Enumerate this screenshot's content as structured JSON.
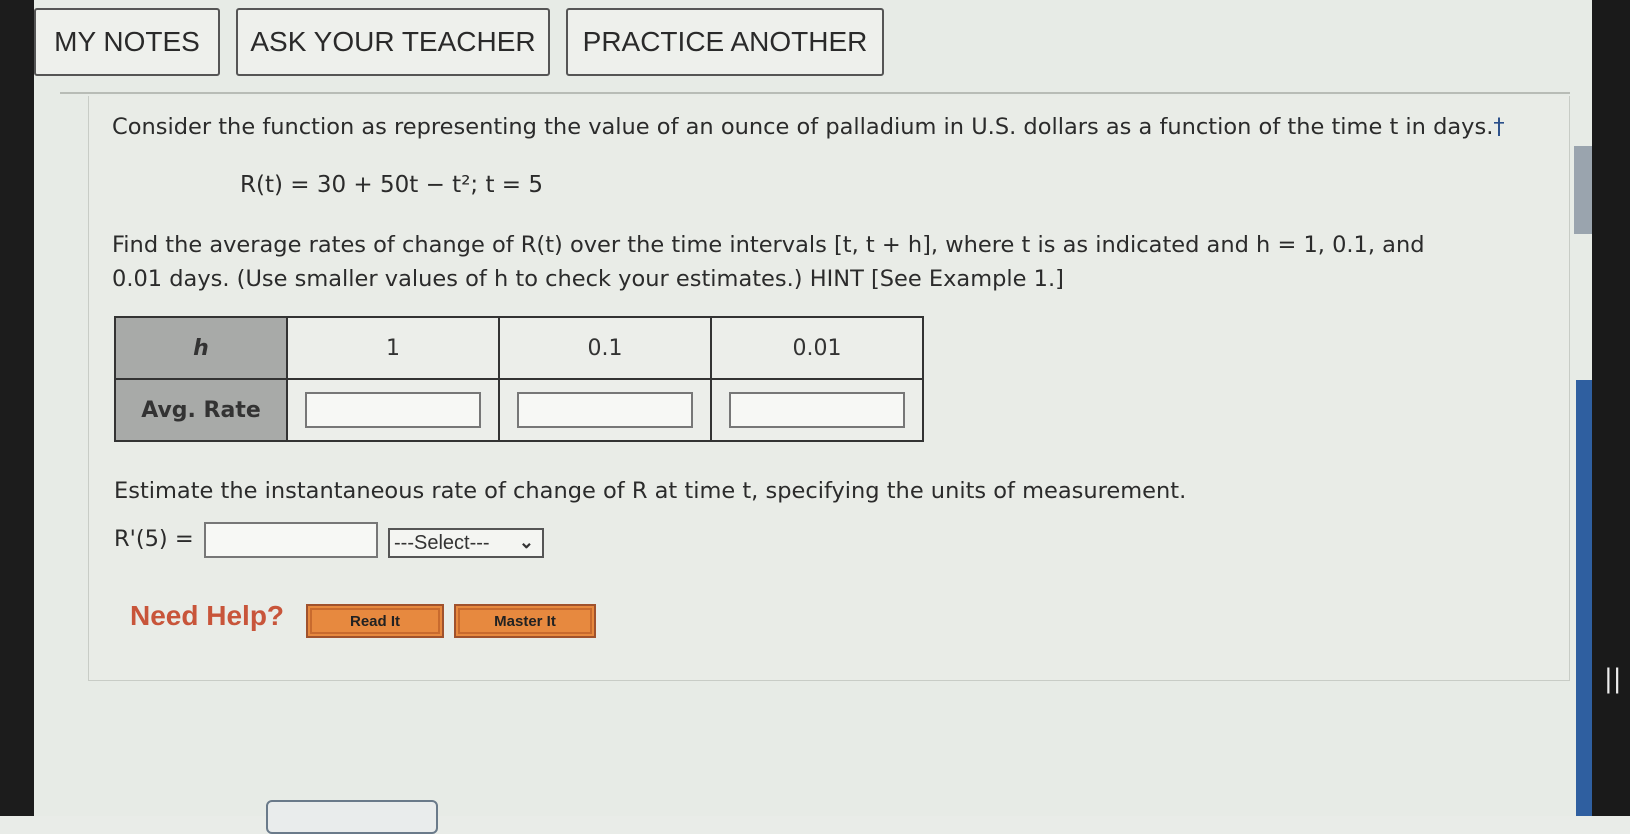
{
  "toolbar": {
    "my_notes": "MY NOTES",
    "ask_teacher": "ASK YOUR TEACHER",
    "practice_another": "PRACTICE ANOTHER"
  },
  "problem": {
    "intro": "Consider the function as representing the value of an ounce of palladium in U.S. dollars as a function of the time t in days.",
    "dagger": "†",
    "function": "R(t) = 30 + 50t − t²; t = 5",
    "instruction_line1": "Find the average rates of change of R(t) over the time intervals [t, t + h], where t is as indicated and h = 1, 0.1, and",
    "instruction_line2": "0.01 days. (Use smaller values of h to check your estimates.) HINT [See Example 1.]"
  },
  "table": {
    "row1_header": "h",
    "h_values": [
      "1",
      "0.1",
      "0.01"
    ],
    "row2_header": "Avg. Rate",
    "avg_rate_values": [
      "",
      "",
      ""
    ]
  },
  "instantaneous": {
    "prompt": "Estimate the instantaneous rate of change of R at time t, specifying the units of measurement.",
    "label": "R'(5) =",
    "value": "",
    "units_select": "---Select---"
  },
  "help": {
    "label": "Need Help?",
    "read_it": "Read It",
    "master_it": "Master It"
  },
  "colors": {
    "help_button": "#e7893f",
    "need_help_text": "#c8553a",
    "table_header": "#a8aaa8"
  }
}
